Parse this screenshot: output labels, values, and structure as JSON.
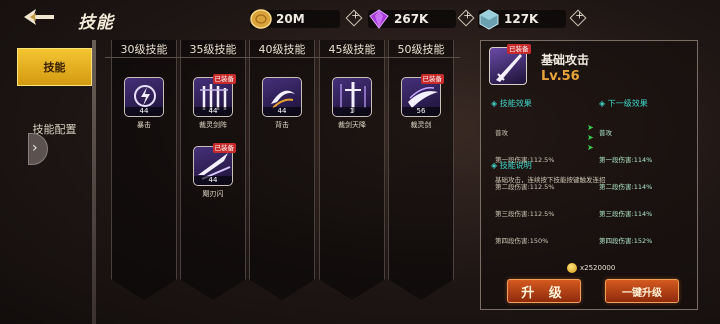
{
  "header": {
    "title": "技能",
    "currencies": [
      {
        "name": "gold-coin-icon",
        "value": "20M"
      },
      {
        "name": "purple-gem-icon",
        "value": "267K"
      },
      {
        "name": "crystal-cube-icon",
        "value": "127K"
      }
    ]
  },
  "sidebar": {
    "items": [
      {
        "label": "技能",
        "active": true
      },
      {
        "label": "技能配置",
        "active": false
      }
    ]
  },
  "columns": [
    {
      "header": "30级技能",
      "skills": [
        {
          "name": "暴击",
          "level": "44",
          "equipped": false
        }
      ]
    },
    {
      "header": "35级技能",
      "skills": [
        {
          "name": "裁灵剑阵",
          "level": "44",
          "equipped": true
        },
        {
          "name": "飓刃闪",
          "level": "44",
          "equipped": true
        }
      ]
    },
    {
      "header": "40级技能",
      "skills": [
        {
          "name": "背击",
          "level": "44",
          "equipped": false
        }
      ]
    },
    {
      "header": "45级技能",
      "skills": [
        {
          "name": "裁剑天降",
          "level": "1",
          "equipped": false
        }
      ]
    },
    {
      "header": "50级技能",
      "skills": [
        {
          "name": "裁灵剑",
          "level": "56",
          "equipped": true
        }
      ]
    }
  ],
  "equipped_tag": "已装备",
  "detail": {
    "name": "基础攻击",
    "level": "Lv.56",
    "effect_title": "技能效果",
    "next_title": "下一级效果",
    "effect_lines": [
      "普攻",
      "第一段伤害:112.5%",
      "第二段伤害:112.5%",
      "第三段伤害:112.5%",
      "第四段伤害:150%"
    ],
    "next_lines": [
      "普攻",
      "第一段伤害:114%",
      "第二段伤害:114%",
      "第三段伤害:114%",
      "第四段伤害:152%"
    ],
    "desc_title": "技能说明",
    "desc": "基础攻击，连续按下技能按键触发连招",
    "cost": "x2520000",
    "upgrade_label": "升 级",
    "one_click_label": "一键升级"
  },
  "colors": {
    "accent_gold": "#f4c531",
    "level_orange": "#e8a33a",
    "teal": "#3fd6c8",
    "button_red": "#d45a20"
  }
}
